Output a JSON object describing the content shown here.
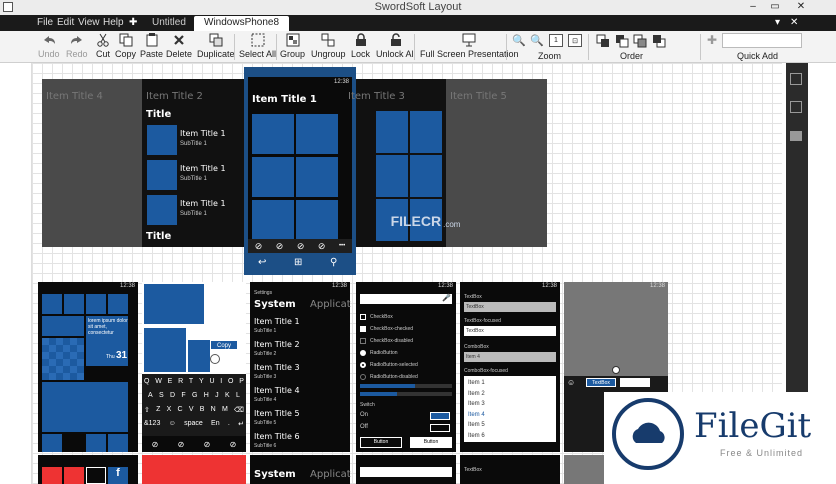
{
  "app": {
    "title": "SwordSoft Layout"
  },
  "window_controls": {
    "minimize": "–",
    "maximize": "▭",
    "close": "✕",
    "close2": "✕",
    "chev": "▾"
  },
  "menu": {
    "file": "File",
    "edit": "Edit",
    "view": "View",
    "help": "Help",
    "add": "✚"
  },
  "tabs": [
    {
      "label": "Untitled"
    },
    {
      "label": "WindowsPhone8"
    }
  ],
  "toolbar": {
    "undo": "Undo",
    "redo": "Redo",
    "cut": "Cut",
    "copy": "Copy",
    "paste": "Paste",
    "delete": "Delete",
    "duplicate": "Duplicate",
    "select_all": "Select All",
    "group": "Group",
    "ungroup": "Ungroup",
    "lock": "Lock",
    "unlock_all": "Unlock All",
    "fullscreen": "Full Screen Presentation",
    "zoom_label": "Zoom",
    "order_label": "Order",
    "quickadd_label": "Quick Add",
    "quickadd_placeholder": ""
  },
  "panorama": {
    "items": [
      "Item Title 4",
      "Item Title 2",
      "Item Title 1",
      "Item Title 3",
      "Item Title 5"
    ],
    "left_title": "Title",
    "left_list": [
      {
        "title": "Item Title 1",
        "sub": "SubTitle 1"
      },
      {
        "title": "Item Title 1",
        "sub": "SubTitle 1"
      },
      {
        "title": "Item Title 1",
        "sub": "SubTitle 1"
      }
    ],
    "left_footer": "Title",
    "time": "12:38",
    "more": "•••"
  },
  "watermark1": {
    "brand": "FILECR",
    "domain": ".com"
  },
  "watermark2": {
    "brand": "FileGit",
    "tagline": "Free & Unlimited"
  },
  "phones": {
    "time": "12:38",
    "p1": {
      "lorem": "lorem ipsum dolor sit amet, consectetur",
      "day": "Thu",
      "date": "31"
    },
    "p2": {
      "copy": "Copy",
      "keys_row1": [
        "Q",
        "W",
        "E",
        "R",
        "T",
        "Y",
        "U",
        "I",
        "O",
        "P"
      ],
      "keys_row2": [
        "A",
        "S",
        "D",
        "F",
        "G",
        "H",
        "J",
        "K",
        "L"
      ],
      "keys_row3": [
        "⇧",
        "Z",
        "X",
        "C",
        "V",
        "B",
        "N",
        "M",
        "⌫"
      ],
      "bottom": [
        "&123",
        "☺",
        "space",
        "En",
        ".",
        "↵"
      ]
    },
    "p3": {
      "settings": "Settings",
      "header": "System",
      "header2": "Applicat",
      "items": [
        {
          "title": "Item Title 1",
          "sub": "SubTitle 1"
        },
        {
          "title": "Item Title 2",
          "sub": "SubTitle 2"
        },
        {
          "title": "Item Title 3",
          "sub": "SubTitle 3"
        },
        {
          "title": "Item Title 4",
          "sub": "SubTitle 4"
        },
        {
          "title": "Item Title 5",
          "sub": "SubTitle 5"
        },
        {
          "title": "Item Title 6",
          "sub": "SubTitle 6"
        }
      ]
    },
    "p4": {
      "items": [
        "CheckBox",
        "CheckBox-checked",
        "CheckBox-disabled",
        "RadioButton",
        "RadioButton-selected",
        "RadioButton-disabled"
      ],
      "switch": "Switch",
      "on": "On",
      "off": "Off",
      "button": "Button",
      "button2": "Button"
    },
    "p5": {
      "tb1": "TextBox",
      "tb1v": "TextBox",
      "tb2": "TextBox-focused",
      "tb2v": "TextBox",
      "combo": "ComboBox",
      "combov": "Item 4",
      "combo2": "ComboBox-focused",
      "list": [
        "Item 1",
        "Item 2",
        "Item 3",
        "Item 4",
        "Item 5",
        "Item 6"
      ]
    },
    "p6": {
      "textbox": "TextBox"
    },
    "bottom": {
      "system": "System",
      "applicat": "Applicat",
      "textbox": "TextBox"
    }
  }
}
